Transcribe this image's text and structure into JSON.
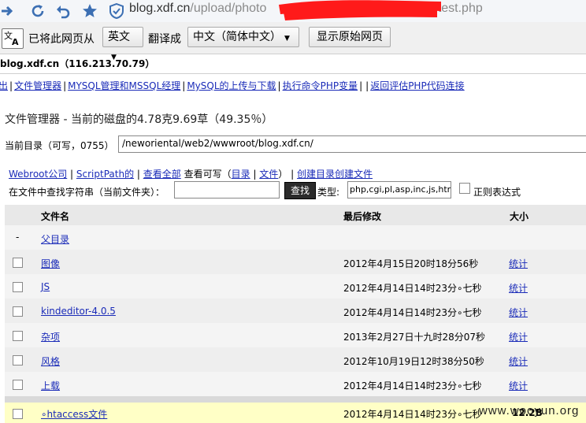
{
  "browser": {
    "url_host": "blog.xdf.cn",
    "url_path_visible": "/upload/photo",
    "url_tail": "/test.php"
  },
  "translate_bar": {
    "prompt": "已将此网页从",
    "from_lang": "英文",
    "action": "翻译成",
    "to_lang": "中文（简体中文）",
    "show_original": "显示原始网页"
  },
  "page": {
    "host": "blog.xdf.cn（116.213.70.79）",
    "nav_links": [
      "登出",
      "文件管理器",
      "MYSQL管理和MSSQL经理",
      "MySQL的上传与下载",
      "执行命令PHP变量",
      "返回评估PHP代码连接"
    ],
    "title": "文件管理器 - 当前的磁盘的4.78克9.69草（49.35％）",
    "cwd_label": "当前目录（可写，0755）",
    "cwd_value": "/neworiental/web2/wwwroot/blog.xdf.cn/",
    "quick": {
      "webroot": "Webroot公司",
      "scriptpath": "ScriptPath的",
      "view_all": "查看全部",
      "view_writable": "查看可写（",
      "dirs": "目录",
      "files": "文件",
      "close": "）",
      "create_dir": "创建目录",
      "create_file": "创建文件"
    },
    "search": {
      "label": "在文件中查找字符串（当前文件夹）：",
      "button": "查找",
      "type_label": "类型:",
      "type_value": "php,cgi,pl,asp,inc,js,htm",
      "regex_label": "正则表达式"
    },
    "table": {
      "col_name": "文件名",
      "col_modified": "最后修改",
      "col_size": "大小",
      "parent_dash": "-",
      "parent_dir": "父目录",
      "rows": [
        {
          "name": "图像",
          "modified": "2012年4月15日20时18分56秒",
          "stat": "统计"
        },
        {
          "name": "JS",
          "modified": "2012年4月14日14时23分∘七秒",
          "stat": "统计"
        },
        {
          "name": "kindeditor-4.0.5",
          "modified": "2012年4月14日14时23分∘七秒",
          "stat": "统计"
        },
        {
          "name": "杂项",
          "modified": "2013年2月27日十九时28分07秒",
          "stat": "统计"
        },
        {
          "name": "风格",
          "modified": "2012年10月19日12时38分50秒",
          "stat": "统计"
        },
        {
          "name": "上载",
          "modified": "2012年4月14日14时23分∘七秒",
          "stat": "统计"
        }
      ],
      "file_row": {
        "name": "∘htaccess文件",
        "modified": "2012年4月14日14时23分∘七秒",
        "size": "12.2B"
      }
    }
  },
  "watermark": "www.wooyun.org"
}
